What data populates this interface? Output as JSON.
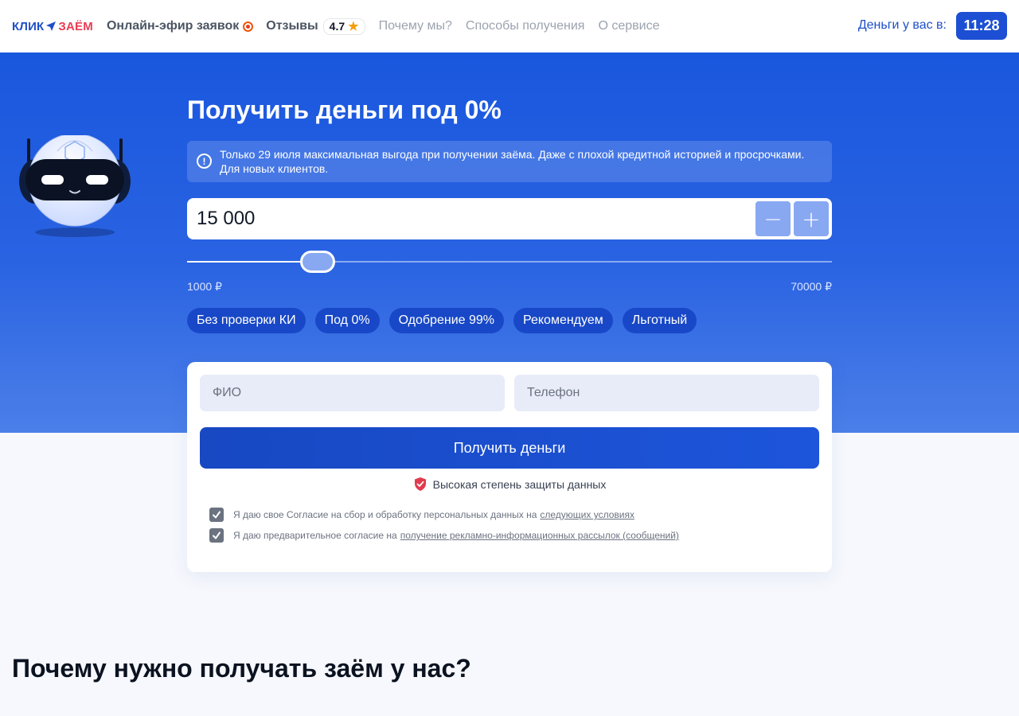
{
  "header": {
    "logo_part1": "КЛИК",
    "logo_part2": "ЗАЁМ",
    "live_label": "Онлайн-эфир заявок",
    "reviews_label": "Отзывы",
    "rating": "4.7",
    "nav": [
      "Почему мы?",
      "Способы получения",
      "О сервисе"
    ],
    "money_label": "Деньги у вас в:",
    "time": "11:28"
  },
  "hero": {
    "title": "Получить деньги под 0%",
    "notice": "Только 29 июля  максимальная выгода при получении заёма. Даже с плохой кредитной историей и просрочками. Для новых клиентов.",
    "amount_value": "15 000",
    "slider": {
      "min": 1000,
      "max": 70000,
      "value": 15000
    },
    "range_min_label": "1000 ₽",
    "range_max_label": "70000 ₽",
    "tags": [
      "Без проверки КИ",
      "Под 0%",
      "Одобрение 99%",
      "Рекомендуем",
      "Льготный"
    ]
  },
  "form": {
    "fio_placeholder": "ФИО",
    "phone_placeholder": "Телефон",
    "submit_label": "Получить деньги",
    "secure_text": "Высокая степень защиты данных",
    "consent1_text": "Я даю свое Согласие на сбор и обработку персональных данных на",
    "consent1_link": "следующих условиях",
    "consent2_text": "Я даю предварительное согласие на",
    "consent2_link": "получение рекламно-информационных рассылок (сообщений)"
  },
  "section_title": "Почему нужно получать заём у нас?",
  "colors": {
    "brand_blue": "#1d4fd4",
    "brand_red": "#ea3b52",
    "hero_top": "#1957de",
    "tag_bg": "#1848c7",
    "star": "#f59e0b"
  }
}
